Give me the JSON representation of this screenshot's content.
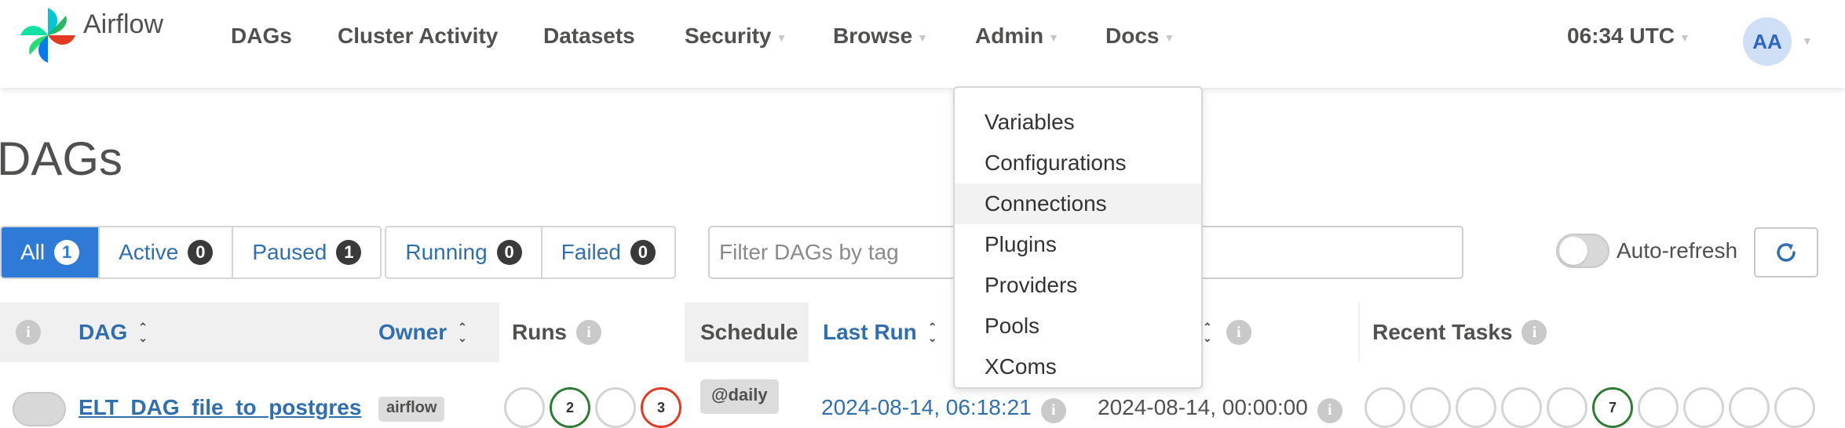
{
  "brand": {
    "name": "Airflow",
    "icon": "airflow-pinwheel-logo"
  },
  "nav": {
    "items": [
      {
        "label": "DAGs",
        "has_caret": false
      },
      {
        "label": "Cluster Activity",
        "has_caret": false
      },
      {
        "label": "Datasets",
        "has_caret": false
      },
      {
        "label": "Security",
        "has_caret": true
      },
      {
        "label": "Browse",
        "has_caret": true
      },
      {
        "label": "Admin",
        "has_caret": true
      },
      {
        "label": "Docs",
        "has_caret": true
      }
    ],
    "time": "06:34 UTC",
    "user_initials": "AA"
  },
  "page": {
    "title": "DAGs"
  },
  "filters": {
    "status_tabs": [
      {
        "label": "All",
        "count": "1",
        "active": true
      },
      {
        "label": "Active",
        "count": "0"
      },
      {
        "label": "Paused",
        "count": "1"
      },
      {
        "label": "Running",
        "count": "0"
      },
      {
        "label": "Failed",
        "count": "0"
      }
    ],
    "tag_placeholder": "Filter DAGs by tag",
    "auto_refresh_label": "Auto-refresh"
  },
  "table": {
    "headers": {
      "dag": "DAG",
      "owner": "Owner",
      "runs": "Runs",
      "schedule": "Schedule",
      "last_run": "Last Run",
      "recent_tasks": "Recent Tasks"
    },
    "rows": [
      {
        "dag_id": "ELT_DAG_file_to_postgres",
        "owner": "airflow",
        "runs": [
          "",
          "2",
          "",
          "3"
        ],
        "schedule": "@daily",
        "last_run": "2024-08-14, 06:18:21",
        "next_run": "2024-08-14, 00:00:00",
        "recent_tasks": [
          "",
          "",
          "",
          "",
          "",
          "7",
          "",
          "",
          "",
          ""
        ]
      }
    ]
  },
  "admin_menu": {
    "items": [
      "Variables",
      "Configurations",
      "Connections",
      "Plugins",
      "Providers",
      "Pools",
      "XComs"
    ],
    "highlighted": "Connections"
  },
  "colors": {
    "link_blue": "#2f6fb0",
    "active_tab": "#2d7bd6",
    "success_green": "#2e7d32",
    "failed_red": "#e43921"
  }
}
